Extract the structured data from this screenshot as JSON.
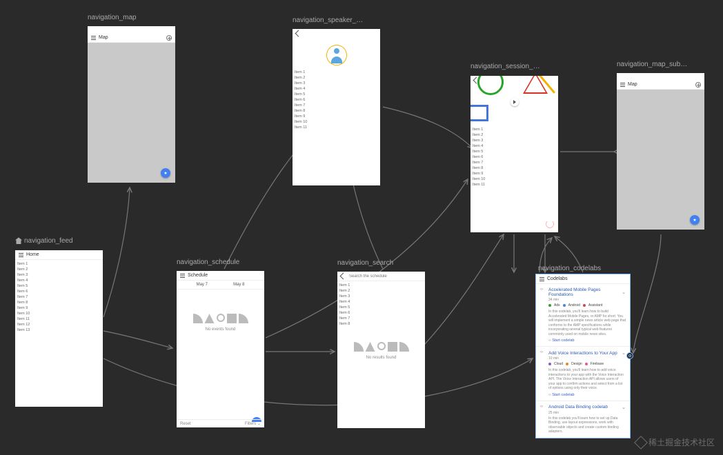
{
  "nodes": {
    "map": {
      "label": "navigation_map",
      "title": "Map"
    },
    "speaker": {
      "label": "navigation_speaker_…",
      "items": [
        "Item 1",
        "Item 2",
        "Item 3",
        "Item 4",
        "Item 5",
        "Item 6",
        "Item 7",
        "Item 8",
        "Item 9",
        "Item 10",
        "Item 11"
      ]
    },
    "session": {
      "label": "navigation_session_…",
      "items": [
        "Item 1",
        "Item 2",
        "Item 3",
        "Item 4",
        "Item 5",
        "Item 6",
        "Item 7",
        "Item 8",
        "Item 9",
        "Item 10",
        "Item 11"
      ]
    },
    "map_sub": {
      "label": "navigation_map_sub…",
      "title": "Map"
    },
    "feed": {
      "label": "navigation_feed",
      "title": "Home",
      "items": [
        "Item 1",
        "Item 2",
        "Item 3",
        "Item 4",
        "Item 5",
        "Item 6",
        "Item 7",
        "Item 8",
        "Item 9",
        "Item 10",
        "Item 11",
        "Item 12",
        "Item 13"
      ]
    },
    "schedule": {
      "label": "navigation_schedule",
      "title": "Schedule",
      "tabs": [
        "May 7",
        "May 8"
      ],
      "empty": "No events found",
      "left_action": "Reset",
      "right_action": "Filters"
    },
    "search": {
      "label": "navigation_search",
      "placeholder": "Search the schedule",
      "items": [
        "Item 1",
        "Item 2",
        "Item 3",
        "Item 4",
        "Item 5",
        "Item 6",
        "Item 7",
        "Item 8"
      ],
      "empty": "No results found"
    },
    "codelabs": {
      "label": "navigation_codelabs",
      "title": "Codelabs",
      "cards": [
        {
          "title": "Accelerated Mobile Pages Foundations",
          "duration": "34 min",
          "tags": [
            [
              "green",
              "Ads"
            ],
            [
              "blue",
              "Android"
            ],
            [
              "red",
              "Assistant"
            ]
          ],
          "desc": "In this codelab, you'll learn how to build Accelerated Mobile Pages, or AMP for short. You will implement a simple news article web page that conforms to the AMP specifications while incorporating several typical web features commonly used on mobile news sites.",
          "link": "Start codelab"
        },
        {
          "title": "Add Voice Interactions to Your App",
          "duration": "10 min",
          "tags": [
            [
              "purple",
              "Cloud"
            ],
            [
              "orange",
              "Design"
            ],
            [
              "pink",
              "Firebase"
            ]
          ],
          "desc": "In this codelab, you'll learn how to add voice interactions to your app with the Voice Interaction API. The Voice Interaction API allows users of your app to confirm actions and select from a list of options using only their voice.",
          "link": "Start codelab"
        },
        {
          "title": "Android Data Binding codelab",
          "duration": "25 min",
          "tags": [],
          "desc": "In this codelab you'll learn how to set up Data Binding, use layout expressions, work with observable objects and create custom binding adapters.",
          "link": ""
        }
      ]
    }
  },
  "watermark": "稀土掘金技术社区"
}
